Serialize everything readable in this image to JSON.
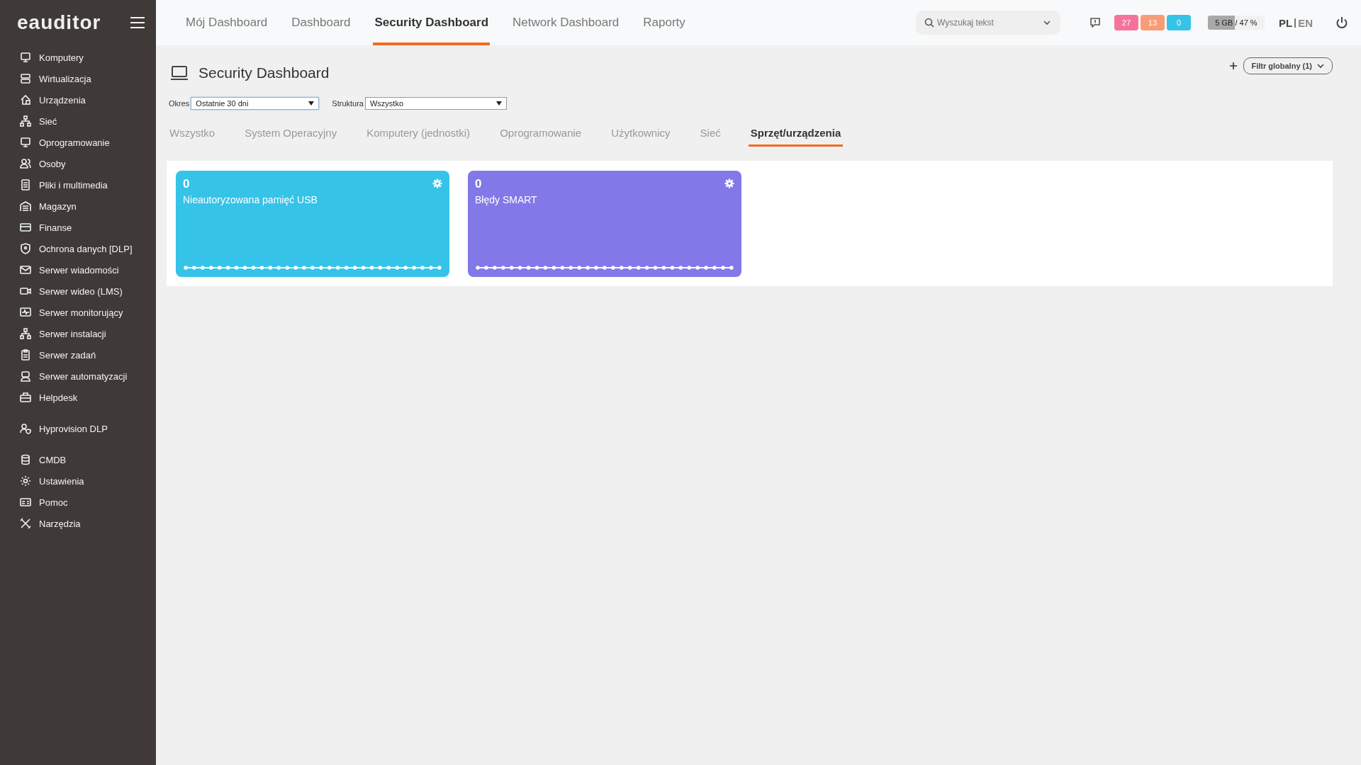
{
  "sidebar": {
    "logo": "eauditor",
    "groups": [
      {
        "items": [
          {
            "label": "Komputery"
          },
          {
            "label": "Wirtualizacja"
          },
          {
            "label": "Urządzenia"
          },
          {
            "label": "Sieć"
          },
          {
            "label": "Oprogramowanie"
          },
          {
            "label": "Osoby"
          },
          {
            "label": "Pliki i multimedia"
          },
          {
            "label": "Magazyn"
          },
          {
            "label": "Finanse"
          },
          {
            "label": "Ochrona danych [DLP]"
          },
          {
            "label": "Serwer wiadomości"
          },
          {
            "label": "Serwer wideo (LMS)"
          },
          {
            "label": "Serwer monitorujący"
          },
          {
            "label": "Serwer instalacji"
          },
          {
            "label": "Serwer zadań"
          },
          {
            "label": "Serwer automatyzacji"
          },
          {
            "label": "Helpdesk"
          }
        ]
      },
      {
        "items": [
          {
            "label": "Hyprovision DLP"
          }
        ]
      },
      {
        "items": [
          {
            "label": "CMDB"
          },
          {
            "label": "Ustawienia"
          },
          {
            "label": "Pomoc"
          },
          {
            "label": "Narzędzia"
          }
        ]
      }
    ]
  },
  "top_nav": {
    "tabs": [
      {
        "label": "Mój Dashboard",
        "selected": false
      },
      {
        "label": "Dashboard",
        "selected": false
      },
      {
        "label": "Security Dashboard",
        "selected": true
      },
      {
        "label": "Network Dashboard",
        "selected": false
      },
      {
        "label": "Raporty",
        "selected": false
      }
    ],
    "search": {
      "placeholder": "Wyszukaj tekst"
    },
    "badges": [
      {
        "count": "27",
        "color": "#f5739a"
      },
      {
        "count": "13",
        "color": "#f89c78"
      },
      {
        "count": "0",
        "color": "#35c3e8"
      }
    ],
    "storage": {
      "text": "5 GB / 47 %",
      "level": 0.47
    },
    "languages": [
      {
        "label": "PL",
        "selected": true
      },
      {
        "label": "EN",
        "selected": false
      }
    ]
  },
  "page": {
    "title": "Security Dashboard",
    "global_filter": "Filtr globalny (1)",
    "filters": [
      {
        "label": "Okres",
        "value": "Ostatnie 30 dni"
      },
      {
        "label": "Struktura",
        "value": "Wszystko"
      }
    ],
    "tabs": [
      {
        "label": "Wszystko",
        "selected": false
      },
      {
        "label": "System Operacyjny",
        "selected": false
      },
      {
        "label": "Komputery (jednostki)",
        "selected": false
      },
      {
        "label": "Oprogramowanie",
        "selected": false
      },
      {
        "label": "Użytkownicy",
        "selected": false
      },
      {
        "label": "Sieć",
        "selected": false
      },
      {
        "label": "Sprzęt/urządzenia",
        "selected": true
      }
    ],
    "widgets": [
      {
        "value": "0",
        "title": "Nieautoryzowana pamięć USB",
        "color": "#35c3e8"
      },
      {
        "value": "0",
        "title": "Błędy SMART",
        "color": "#8378e8"
      }
    ]
  }
}
